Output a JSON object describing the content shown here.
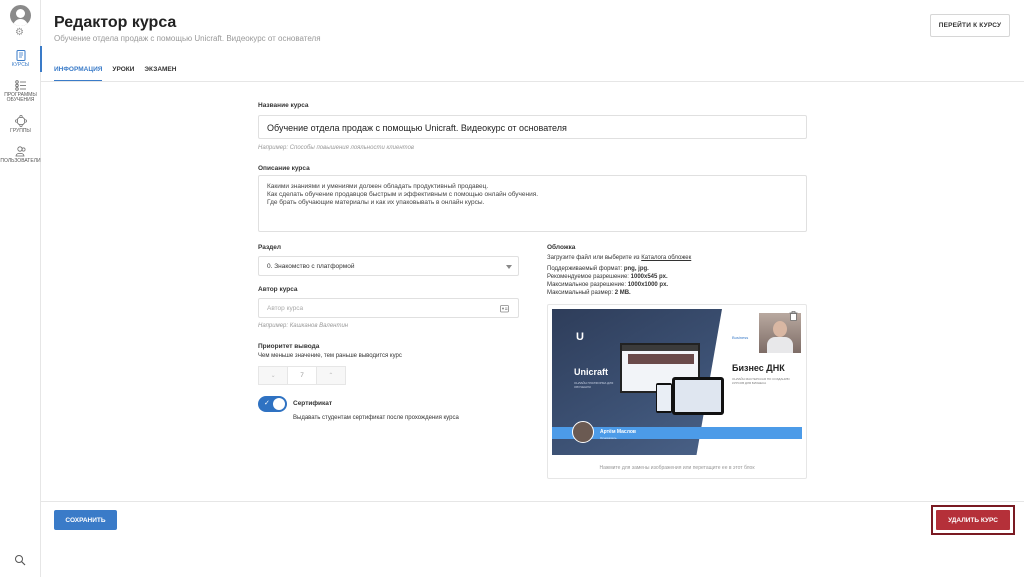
{
  "sidebar": {
    "items": [
      {
        "label": "КУРСЫ",
        "icon": "courses-icon",
        "active": true
      },
      {
        "label": "ПРОГРАММЫ ОБУЧЕНИЯ",
        "icon": "programs-icon"
      },
      {
        "label": "ГРУППЫ",
        "icon": "groups-icon"
      },
      {
        "label": "ПОЛЬЗОВАТЕЛИ",
        "icon": "users-icon"
      }
    ]
  },
  "header": {
    "title": "Редактор курса",
    "subtitle": "Обучение отдела продаж с помощью Unicraft. Видеокурс от основателя",
    "goto_label": "ПЕРЕЙТИ К КУРСУ"
  },
  "tabs": [
    {
      "label": "ИНФОРМАЦИЯ",
      "active": true
    },
    {
      "label": "УРОКИ"
    },
    {
      "label": "ЭКЗАМЕН"
    }
  ],
  "form": {
    "name_label": "Название курса",
    "name_value": "Обучение отдела продаж с помощью Unicraft. Видеокурс от основателя",
    "name_hint": "Например: Способы повышения лояльности клиентов",
    "desc_label": "Описание курса",
    "desc_lines": [
      "Какими знаниями и умениями должен обладать продуктивный продавец.",
      "Как сделать обучение продавцов быстрым и эффективным с помощью онлайн обучения.",
      "Где брать обучающие материалы и как их упаковывать в онлайн курсы."
    ],
    "section_label": "Раздел",
    "section_value": "0. Знакомство с платформой",
    "author_label": "Автор курса",
    "author_placeholder": "Автор курса",
    "author_hint": "Например: Кашканов Валентин",
    "priority_label": "Приоритет вывода",
    "priority_hint": "Чем меньше значение, тем раньше выводится курс",
    "priority_value": "7",
    "cert_label": "Сертификат",
    "cert_desc": "Выдавать студентам сертификат после прохождения курса",
    "cert_enabled": true
  },
  "cover": {
    "label": "Обложка",
    "upload_text": "Загрузите файл или выберите из",
    "catalog_link": "Каталога обложек",
    "formats_label": "Поддерживаемый формат:",
    "formats_value": "png, jpg.",
    "rec_label": "Рекомендуемое разрешение:",
    "rec_value": "1000x545 px.",
    "max_res_label": "Максимальное разрешение:",
    "max_res_value": "1000x1000 px.",
    "max_size_label": "Максимальный размер:",
    "max_size_value": "2 MB.",
    "caption": "Нажмите для замены изображения или перетащите ее в этот блок",
    "image": {
      "logo": "U",
      "brand": "Unicraft",
      "brand_sub": "ОНЛАЙН ПЛАТФОРМА ДЛЯ ОБУЧЕНИЯ",
      "mini": "Business",
      "biz_title": "Бизнес ДНК",
      "biz_sub": "ОНЛАЙН МАСТЕРСКАЯ ПО СОЗДАНИЮ КУРСОВ ДЛЯ БИЗНЕСА",
      "person_name": "Артём Маслов",
      "person_role": "Основатель"
    }
  },
  "footer": {
    "save_label": "СОХРАНИТЬ",
    "delete_label": "УДАЛИТЬ КУРС"
  },
  "colors": {
    "accent": "#3a7bc8",
    "danger": "#b53039",
    "danger_outline": "#7a1a22"
  }
}
